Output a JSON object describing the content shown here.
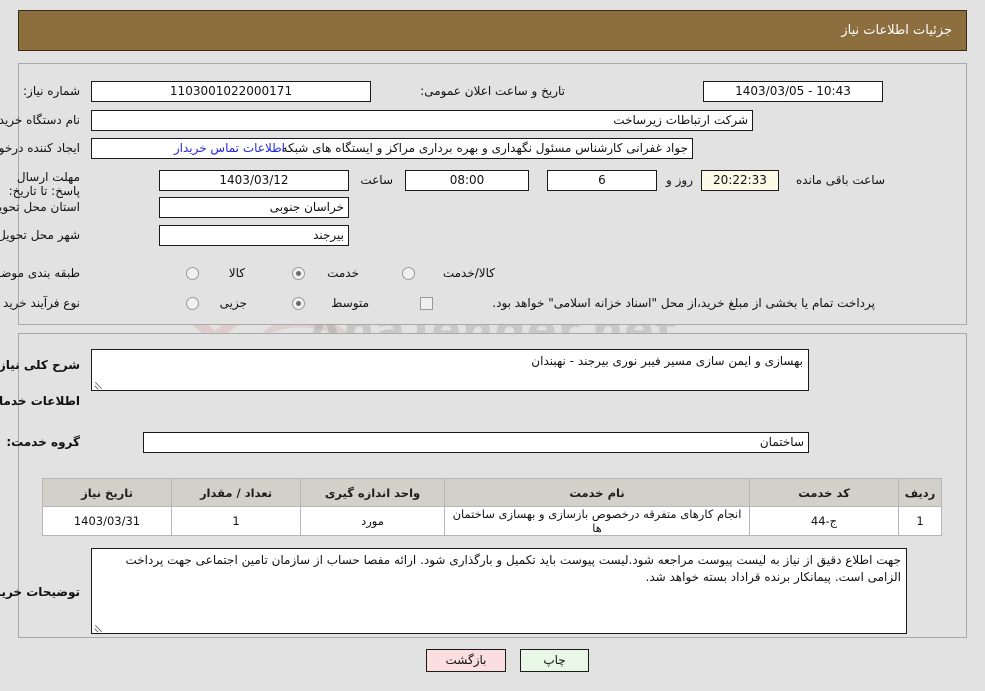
{
  "header": {
    "title": "جزئیات اطلاعات نیاز"
  },
  "watermark": {
    "text": "AnaTender.net"
  },
  "form": {
    "need_number_label": "شماره نیاز:",
    "need_number_value": "1103001022000171",
    "announcement_label": "تاریخ و ساعت اعلان عمومی:",
    "announcement_value": "1403/03/05 - 10:43",
    "buyer_org_label": "نام دستگاه خریدار:",
    "buyer_org_value": "شرکت ارتباطات زیرساخت",
    "requester_label": "ایجاد کننده درخواست:",
    "requester_value": "جواد غفرانی کارشناس مسئول نگهداری و بهره برداری مراکز و ایستگاه های شبکه",
    "buyer_contact_link": "اطلاعات تماس خریدار",
    "deadline_label": "مهلت ارسال پاسخ: تا تاریخ:",
    "deadline_date": "1403/03/12",
    "deadline_time_label": "ساعت",
    "deadline_time": "08:00",
    "remaining_days": "6",
    "remaining_days_label": "روز و",
    "remaining_clock": "20:22:33",
    "remaining_hours_label": "ساعت باقی مانده",
    "province_label": "استان محل تحویل:",
    "province_value": "خراسان جنوبی",
    "city_label": "شهر محل تحویل:",
    "city_value": "بیرجند",
    "category_label": "طبقه بندی موضوعی:",
    "category_options": [
      {
        "label": "کالا",
        "selected": false
      },
      {
        "label": "خدمت",
        "selected": true
      },
      {
        "label": "کالا/خدمت",
        "selected": false
      }
    ],
    "purchase_type_label": "نوع فرآیند خرید :",
    "purchase_type_options": [
      {
        "label": "جزیی",
        "selected": false
      },
      {
        "label": "متوسط",
        "selected": true
      }
    ],
    "treasury_checkbox_label": "پرداخت تمام یا بخشی از مبلغ خرید،از محل \"اسناد خزانه اسلامی\" خواهد بود.",
    "treasury_checked": false
  },
  "description": {
    "label": "شرح کلی نیاز:",
    "value": "بهسازی و ایمن سازی مسیر فیبر نوری بیرجند - نهبندان"
  },
  "services_section": {
    "heading": "اطلاعات خدمات مورد نیاز",
    "group_label": "گروه خدمت:",
    "group_value": "ساختمان"
  },
  "table": {
    "columns": [
      "ردیف",
      "کد خدمت",
      "نام خدمت",
      "واحد اندازه گیری",
      "تعداد / مقدار",
      "تاریخ نیاز"
    ],
    "rows": [
      {
        "row": "1",
        "code": "ج-44",
        "name": "انجام کارهای متفرقه درخصوص بازسازی و بهسازی ساختمان ها",
        "unit": "مورد",
        "qty": "1",
        "date": "1403/03/31"
      }
    ]
  },
  "buyer_notes": {
    "label": "توضیحات خریدار:",
    "value": "جهت اطلاع دقیق از نیاز به لیست پیوست مراجعه شود.لیست پیوست باید تکمیل و بارگذاری شود. ارائه مفصا حساب از سازمان تامین اجتماعی جهت پرداخت الزامی است. پیمانکار برنده قراداد بسته خواهد شد."
  },
  "footer": {
    "print_label": "چاپ",
    "back_label": "بازگشت"
  },
  "colors": {
    "header_bar": "#8d6e3f",
    "page_bg": "#e2e2e2",
    "link": "#2626e0",
    "back_button": "#fbdede",
    "print_button": "#e9f7e7",
    "table_header": "#d3cfc9"
  }
}
